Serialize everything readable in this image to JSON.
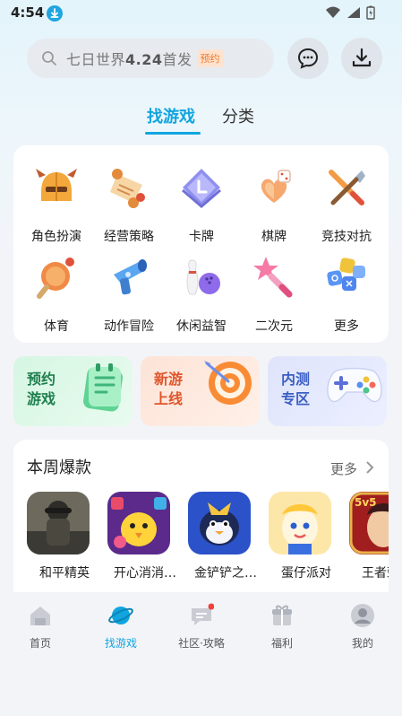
{
  "status": {
    "time": "4:54"
  },
  "search": {
    "placeholder_prefix": "七日世界",
    "placeholder_bold": "4.24",
    "placeholder_suffix": "首发",
    "tag": "预约"
  },
  "tabs": [
    {
      "label": "找游戏",
      "active": true
    },
    {
      "label": "分类",
      "active": false
    }
  ],
  "categories": [
    {
      "label": "角色扮演",
      "icon": "helmet-icon"
    },
    {
      "label": "经营策略",
      "icon": "scroll-icon"
    },
    {
      "label": "卡牌",
      "icon": "card-icon"
    },
    {
      "label": "棋牌",
      "icon": "dice-icon"
    },
    {
      "label": "竞技对抗",
      "icon": "swords-icon"
    },
    {
      "label": "体育",
      "icon": "ping-pong-icon"
    },
    {
      "label": "动作冒险",
      "icon": "blaster-icon"
    },
    {
      "label": "休闲益智",
      "icon": "bowling-icon"
    },
    {
      "label": "二次元",
      "icon": "magic-wand-icon"
    },
    {
      "label": "更多",
      "icon": "more-grid-icon"
    }
  ],
  "banners": [
    {
      "label_line1": "预约",
      "label_line2": "游戏",
      "color": "#1f7f4e"
    },
    {
      "label_line1": "新游",
      "label_line2": "上线",
      "color": "#e0562a"
    },
    {
      "label_line1": "内测",
      "label_line2": "专区",
      "color": "#3b5fc4"
    }
  ],
  "weekly": {
    "title": "本周爆款",
    "more": "更多",
    "games": [
      {
        "name": "和平精英"
      },
      {
        "name": "开心消消…"
      },
      {
        "name": "金铲铲之…"
      },
      {
        "name": "蛋仔派对"
      },
      {
        "name": "王者荣耀"
      }
    ]
  },
  "nav": [
    {
      "label": "首页",
      "icon": "home-icon"
    },
    {
      "label": "找游戏",
      "icon": "planet-icon",
      "active": true
    },
    {
      "label": "社区·攻略",
      "icon": "chat-icon"
    },
    {
      "label": "福利",
      "icon": "gift-icon"
    },
    {
      "label": "我的",
      "icon": "profile-icon"
    }
  ],
  "colors": {
    "accent": "#10a5df",
    "tag": "#f07a2c"
  }
}
